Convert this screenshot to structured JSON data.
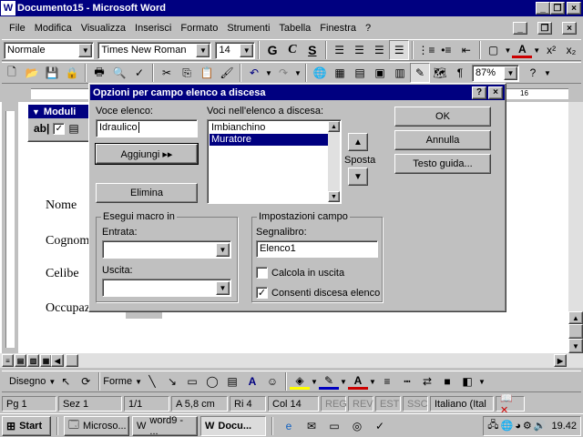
{
  "app": {
    "title": "Documento15 - Microsoft Word"
  },
  "menu": [
    "File",
    "Modifica",
    "Visualizza",
    "Inserisci",
    "Formato",
    "Strumenti",
    "Tabella",
    "Finestra",
    "?"
  ],
  "formatting": {
    "style": "Normale",
    "font": "Times New Roman",
    "size": "14",
    "bold": "G",
    "italic": "C",
    "underline": "S"
  },
  "standard": {
    "zoom": "87%"
  },
  "ruler": {
    "mark_16": "16"
  },
  "forms_toolbar": {
    "title": "Moduli",
    "text_field": "ab|"
  },
  "document": {
    "lines": [
      "Nome",
      "Cognom",
      "Celibe",
      "Occupazione"
    ]
  },
  "dialog": {
    "title": "Opzioni per campo elenco a discesa",
    "help_btn": "?",
    "close_btn": "×",
    "voce_label": "Voce elenco:",
    "voce_value": "Idraulico",
    "aggiungi": "Aggiungi ▸▸",
    "elimina": "Elimina",
    "voci_label": "Voci nell'elenco a discesa:",
    "voci": [
      "Imbianchino",
      "Muratore"
    ],
    "selected_index": 1,
    "sposta": "Sposta",
    "ok": "OK",
    "annulla": "Annulla",
    "testo_guida": "Testo guida...",
    "macro_group": "Esegui macro in",
    "entrata": "Entrata:",
    "uscita": "Uscita:",
    "impostazioni_group": "Impostazioni campo",
    "segnalibro": "Segnalibro:",
    "segnalibro_value": "Elenco1",
    "calcola": "Calcola in uscita",
    "calcola_checked": false,
    "consenti": "Consenti discesa elenco",
    "consenti_checked": true
  },
  "drawing": {
    "disegno": "Disegno",
    "forme": "Forme"
  },
  "status": {
    "page": "Pg 1",
    "section": "Sez 1",
    "pages": "1/1",
    "at": "A 5,8 cm",
    "line": "Ri 4",
    "col": "Col 14",
    "reg": "REG",
    "rev": "REV",
    "est": "EST",
    "ssc": "SSC",
    "language": "Italiano (Ital"
  },
  "taskbar": {
    "start": "Start",
    "tasks": [
      "Microso...",
      "word9 - ...",
      "Docu..."
    ],
    "clock": "19.42"
  }
}
